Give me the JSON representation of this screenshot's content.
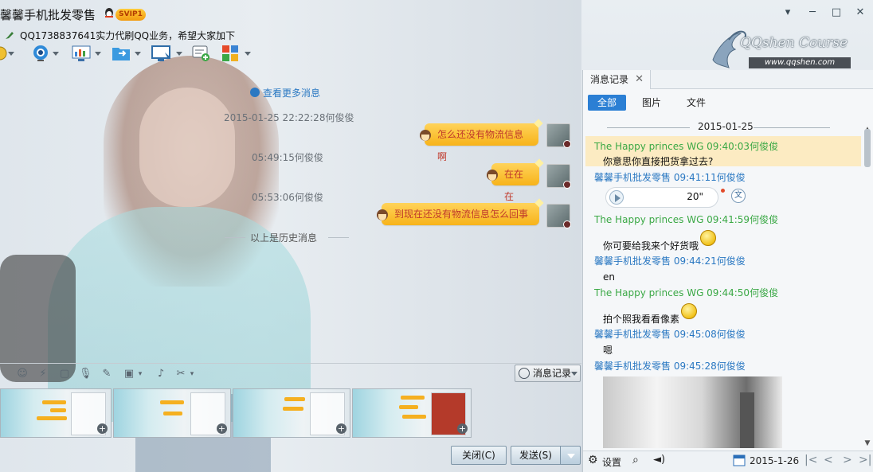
{
  "window": {
    "title": "馨馨手机批发零售",
    "badge": "SVIP1",
    "signature": "QQ1738837641实力代刷QQ业务，希望大家加下",
    "controls": {
      "menu": "▾",
      "minimize": "─",
      "maximize": "□",
      "close": "✕"
    }
  },
  "brand": {
    "logo_text": "QQshen Course",
    "logo_url": "www.qqshen.com"
  },
  "toolbar": {
    "icons": [
      "phone-icon",
      "video-icon",
      "screen-share-icon",
      "file-transfer-icon",
      "remote-desktop-icon",
      "create-discussion-icon",
      "apps-icon"
    ]
  },
  "chat": {
    "more_link": "查看更多消息",
    "messages": [
      {
        "time": "2015-01-25 22:22:28何俊俊",
        "text": "怎么还没有物流信息啊"
      },
      {
        "time": "05:49:15何俊俊",
        "text": "在在在"
      },
      {
        "time": "05:53:06何俊俊",
        "text": "到现在还没有物流信息怎么回事"
      }
    ],
    "history_divider": "以上是历史消息"
  },
  "input_toolbar": {
    "icons": [
      "emoji-icon",
      "shake-icon",
      "font-icon",
      "mic-icon",
      "edit-icon",
      "image-icon",
      "music-icon",
      "scissors-icon"
    ],
    "history_button": "消息记录"
  },
  "actions": {
    "close": "关闭(C)",
    "send": "发送(S)"
  },
  "history_pane": {
    "tab": "消息记录",
    "filters": [
      "全部",
      "图片",
      "文件"
    ],
    "date": "2015-01-25",
    "entries": [
      {
        "sender": "The Happy princes  WG 09:40:03何俊俊",
        "body": "你意思你直接把货拿过去?"
      },
      {
        "sender": "馨馨手机批发零售 09:41:11何俊俊",
        "voice_duration": "20\"",
        "convert": "文"
      },
      {
        "sender": "The Happy princes  WG 09:41:59何俊俊",
        "body": "你可要给我来个好货哦"
      },
      {
        "sender": "馨馨手机批发零售 09:44:21何俊俊",
        "body": "en"
      },
      {
        "sender": "The Happy princes  WG 09:44:50何俊俊",
        "body": "拍个照我看看像素"
      },
      {
        "sender": "馨馨手机批发零售 09:45:08何俊俊",
        "body": "嗯"
      },
      {
        "sender": "馨馨手机批发零售 09:45:28何俊俊"
      }
    ],
    "bottom": {
      "settings": "设置",
      "date": "2015-1-26"
    }
  },
  "colors": {
    "accent": "#2b7fd4",
    "bubble": "#f7b31a",
    "green_sender": "#3aa845",
    "blue_sender": "#2a78c2"
  }
}
